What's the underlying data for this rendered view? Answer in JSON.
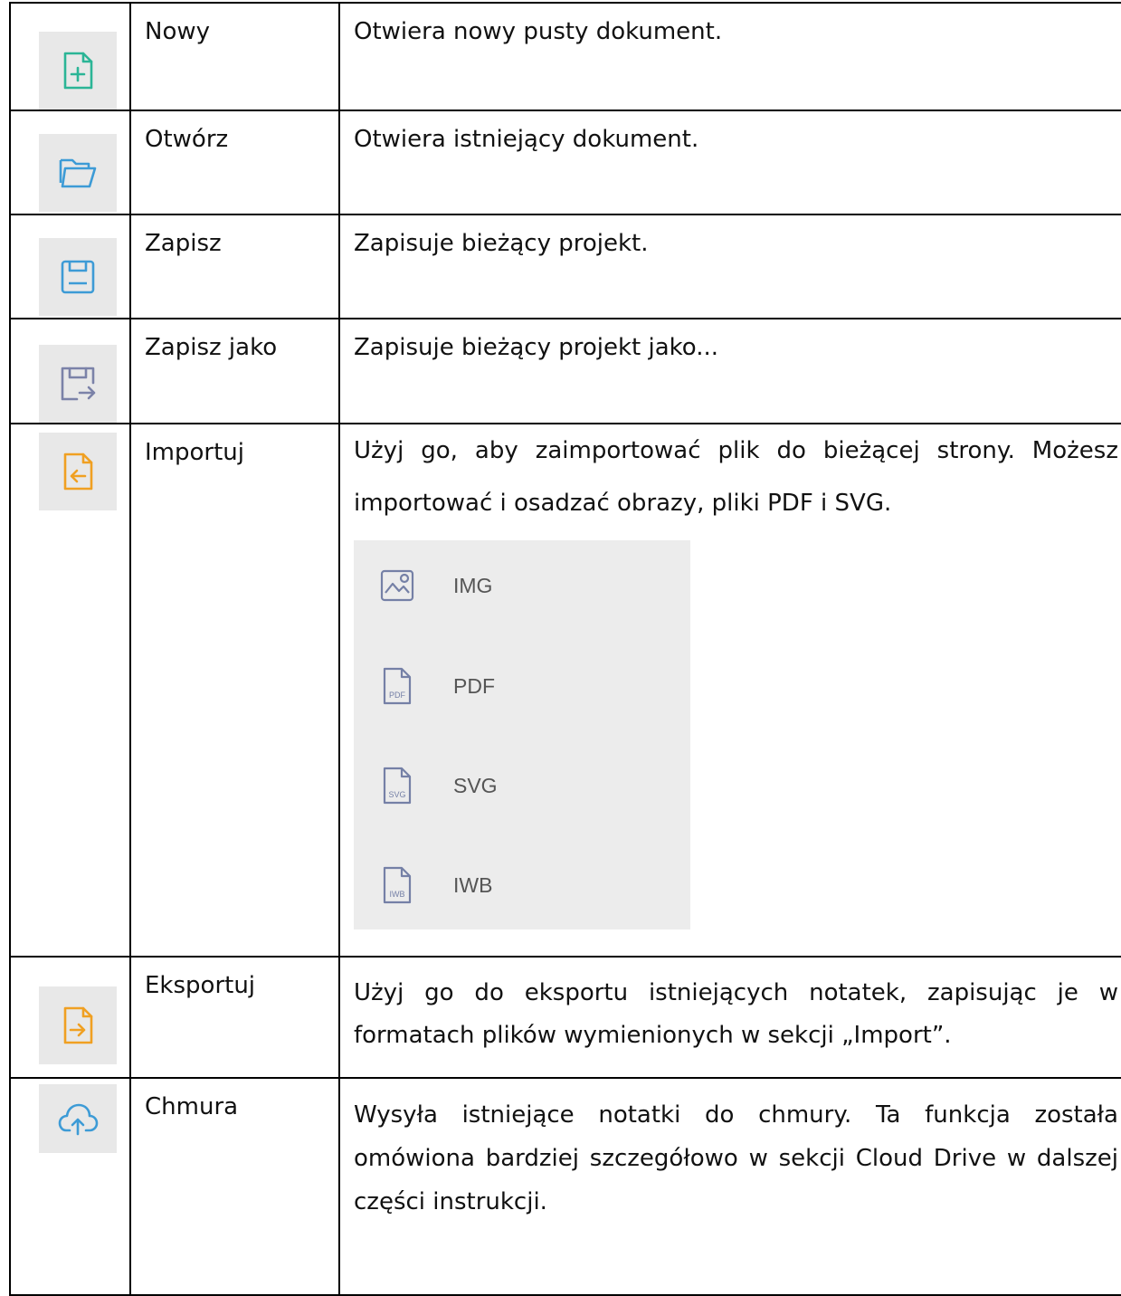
{
  "rows": [
    {
      "icon": "new-file-icon",
      "name": "Nowy",
      "desc": "Otwiera nowy pusty dokument."
    },
    {
      "icon": "open-folder-icon",
      "name": "Otwórz",
      "desc": "Otwiera istniejący dokument."
    },
    {
      "icon": "save-icon",
      "name": "Zapisz",
      "desc": "Zapisuje bieżący projekt."
    },
    {
      "icon": "save-as-icon",
      "name": "Zapisz jako",
      "desc": "Zapisuje bieżący projekt jako..."
    },
    {
      "icon": "import-icon",
      "name": "Importuj",
      "desc": "Użyj go, aby zaimportować plik do bieżącej strony. Możesz importować i osadzać obrazy, pliki PDF i SVG."
    },
    {
      "icon": "export-icon",
      "name": "Eksportuj",
      "desc": "Użyj go do eksportu istniejących notatek, zapisując je w formatach plików wymienionych w sekcji „Import”."
    },
    {
      "icon": "cloud-upload-icon",
      "name": "Chmura",
      "desc": "Wysyła istniejące notatki do chmury. Ta funkcja została omówiona bardziej szczegółowo w sekcji Cloud Drive w dalszej części instrukcji."
    }
  ],
  "import_options": [
    {
      "icon": "image-file-icon",
      "label": "IMG"
    },
    {
      "icon": "pdf-file-icon",
      "label": "PDF",
      "badge": "PDF"
    },
    {
      "icon": "svg-file-icon",
      "label": "SVG",
      "badge": "SVG"
    },
    {
      "icon": "iwb-file-icon",
      "label": "IWB",
      "badge": "IWB"
    }
  ],
  "colors": {
    "new": "#2bb596",
    "open": "#3d9bd6",
    "save": "#3d9bd6",
    "save_as": "#7b82a8",
    "import": "#f0a022",
    "export": "#f0a022",
    "cloud": "#3d9bd6",
    "file_gray": "#7580a6"
  }
}
